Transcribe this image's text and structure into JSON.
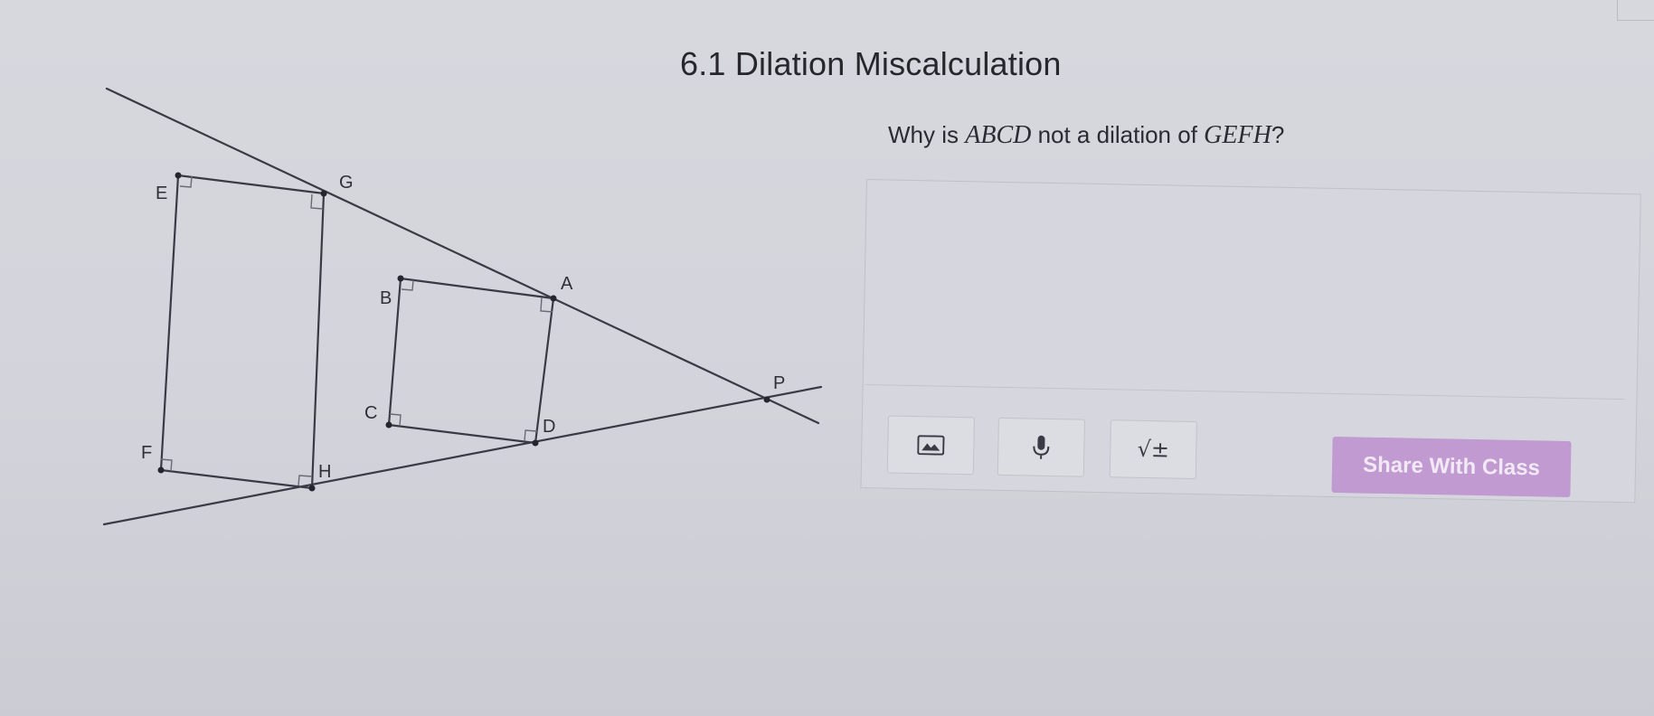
{
  "activity": {
    "title": "6.1 Dilation Miscalculation"
  },
  "question": {
    "prefix": "Why is ",
    "shape1": "ABCD",
    "middle": " not a dilation of ",
    "shape2": "GEFH",
    "suffix": "?"
  },
  "figure": {
    "labels": {
      "E": "E",
      "G": "G",
      "F": "F",
      "H": "H",
      "B": "B",
      "A": "A",
      "C": "C",
      "D": "D",
      "P": "P"
    }
  },
  "response": {
    "value": "",
    "placeholder": ""
  },
  "toolbar": {
    "image_icon": "image-icon",
    "mic_icon": "microphone-icon",
    "math_icon": "square-root-icon",
    "math_symbol": "√±",
    "share_label": "Share With Class"
  },
  "colors": {
    "share_button": "#c29ad2",
    "share_text": "#f1eaf4",
    "background": "#d5d6dd"
  }
}
